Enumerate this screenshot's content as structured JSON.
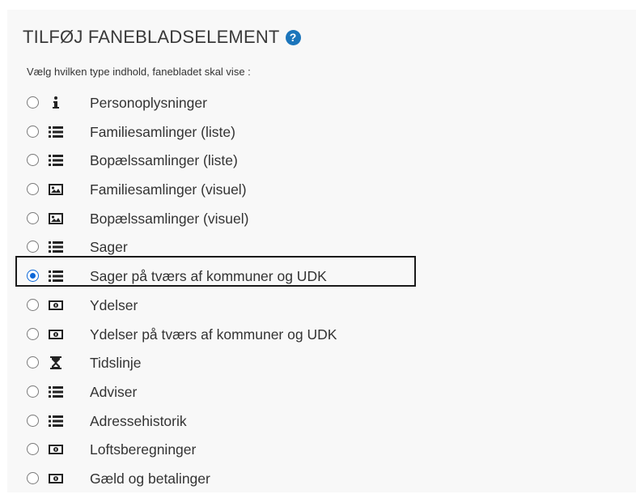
{
  "heading": {
    "title": "TILFØJ FANEBLADSELEMENT",
    "help_glyph": "?",
    "subtitle": "Vælg hvilken type indhold, fanebladet skal vise :"
  },
  "options": [
    {
      "label": "Personoplysninger",
      "icon": "info-icon",
      "selected": false
    },
    {
      "label": "Familiesamlinger (liste)",
      "icon": "list-icon",
      "selected": false
    },
    {
      "label": "Bopælssamlinger (liste)",
      "icon": "list-icon",
      "selected": false
    },
    {
      "label": "Familiesamlinger (visuel)",
      "icon": "image-icon",
      "selected": false
    },
    {
      "label": "Bopælssamlinger (visuel)",
      "icon": "image-icon",
      "selected": false
    },
    {
      "label": "Sager",
      "icon": "list-icon",
      "selected": false
    },
    {
      "label": "Sager på tværs af kommuner og UDK",
      "icon": "list-icon",
      "selected": true
    },
    {
      "label": "Ydelser",
      "icon": "money-icon",
      "selected": false
    },
    {
      "label": "Ydelser på tværs af kommuner og UDK",
      "icon": "money-icon",
      "selected": false
    },
    {
      "label": "Tidslinje",
      "icon": "hourglass-icon",
      "selected": false
    },
    {
      "label": "Adviser",
      "icon": "list-icon",
      "selected": false
    },
    {
      "label": "Adressehistorik",
      "icon": "list-icon",
      "selected": false
    },
    {
      "label": "Loftsberegninger",
      "icon": "money-icon",
      "selected": false
    },
    {
      "label": "Gæld og betalinger",
      "icon": "money-icon",
      "selected": false
    }
  ],
  "colors": {
    "panel_background": "#f8f8f8",
    "help_icon": "#1b75bb",
    "radio_selected": "#0a66d8",
    "highlight_border": "#1a1a1a"
  }
}
